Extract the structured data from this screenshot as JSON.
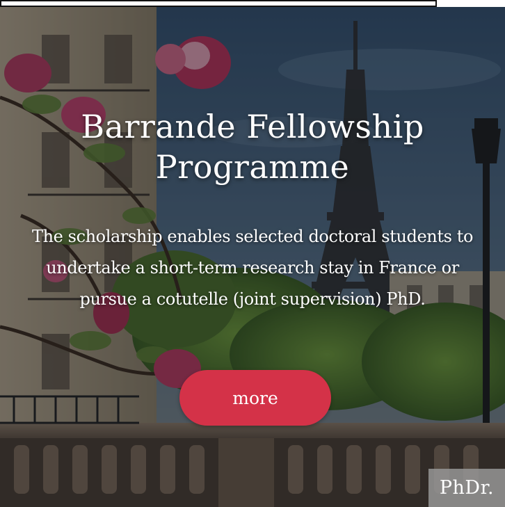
{
  "hero": {
    "title": "Barrande Fellowship Programme",
    "description": "The scholarship enables selected doctoral students to undertake a short-term research stay in France or pursue a cotutelle (joint supervision) PhD.",
    "more_label": "more",
    "button_color": "#d43248",
    "background_icon": "paris-eiffel-tower-photo"
  },
  "corner_tag": {
    "label": "PhDr."
  }
}
